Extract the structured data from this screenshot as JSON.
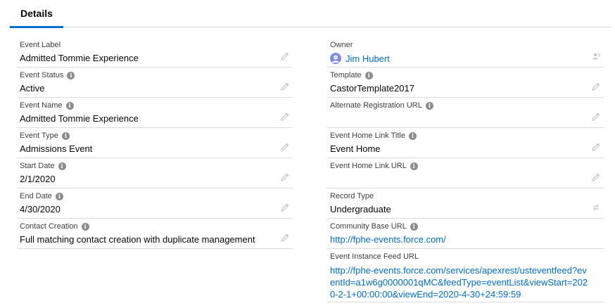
{
  "tabs": {
    "details_label": "Details"
  },
  "left_fields": [
    {
      "label": "Event Label",
      "value": "Admitted Tommie Experience"
    },
    {
      "label": "Event Status",
      "value": "Active"
    },
    {
      "label": "Event Name",
      "value": "Admitted Tommie Experience"
    },
    {
      "label": "Event Type",
      "value": "Admissions Event"
    },
    {
      "label": "Start Date",
      "value": "2/1/2020"
    },
    {
      "label": "End Date",
      "value": "4/30/2020"
    },
    {
      "label": "Contact Creation",
      "value": "Full matching contact creation with duplicate management"
    }
  ],
  "right_fields": [
    {
      "label": "Owner",
      "value": "Jim Hubert"
    },
    {
      "label": "Template",
      "value": "CastorTemplate2017"
    },
    {
      "label": "Alternate Registration URL",
      "value": ""
    },
    {
      "label": "Event Home Link Title",
      "value": "Event Home"
    },
    {
      "label": "Event Home Link URL",
      "value": ""
    },
    {
      "label": "Record Type",
      "value": "Undergraduate"
    },
    {
      "label": "Community Base URL",
      "value": "http://fphe-events.force.com/"
    },
    {
      "label": "Event Instance Feed URL",
      "value": "http://fphe-events.force.com/services/apexrest/usteventfeed?eventId=a1w6g0000001qMC&feedType=eventList&viewStart=2020-2-1+00:00:00&viewEnd=2020-4-30+24:59:59"
    }
  ],
  "icons": {
    "info": "info-icon",
    "edit": "pencil-icon",
    "owner_change": "change-owner-icon",
    "record_type_change": "change-record-type-icon",
    "avatar": "user-avatar"
  },
  "colors": {
    "accent": "#0070d2",
    "link": "#006dcc",
    "label": "#3e3e3c",
    "divider": "#dddbda",
    "icon_gray": "#c9c7c5",
    "info_gray": "#8c8c8c"
  }
}
